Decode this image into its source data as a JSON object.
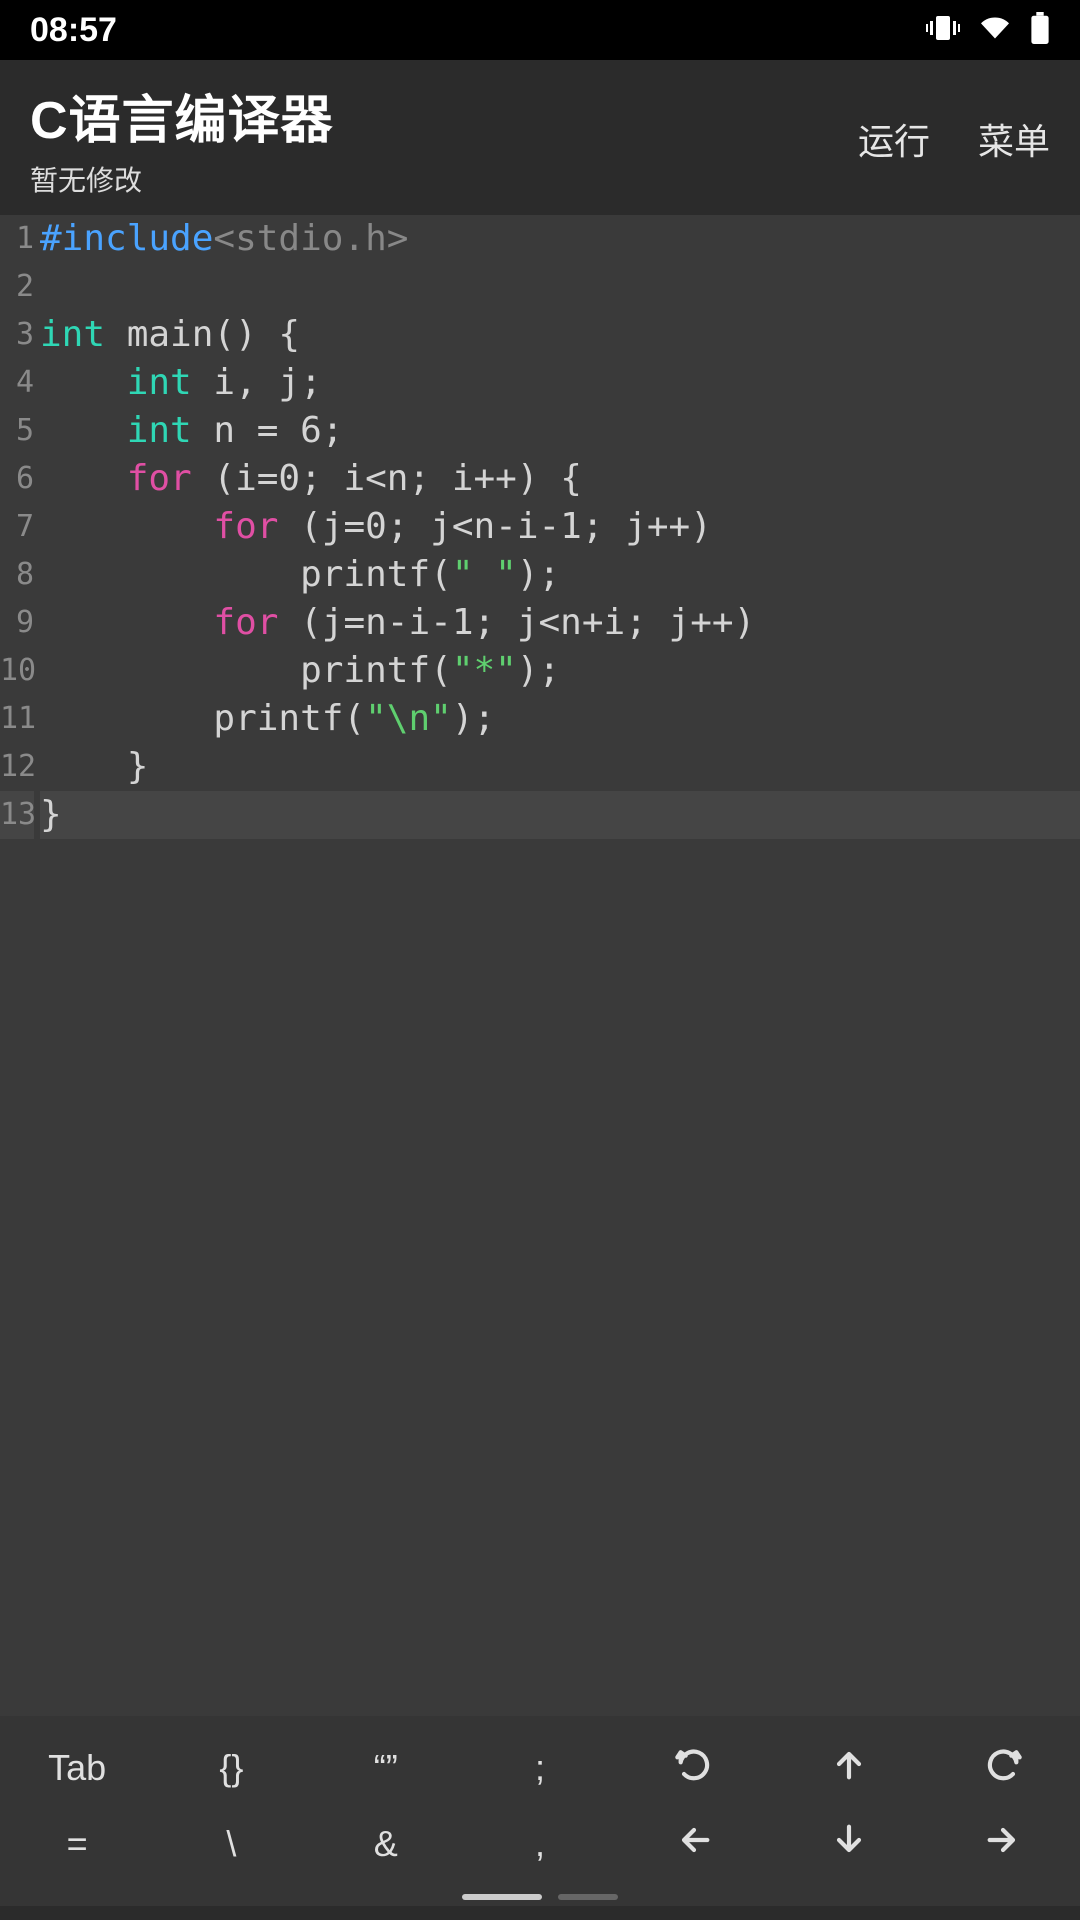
{
  "status": {
    "time": "08:57"
  },
  "header": {
    "title": "C语言编译器",
    "subtitle": "暂无修改",
    "run_label": "运行",
    "menu_label": "菜单"
  },
  "code": {
    "lines": [
      {
        "no": "1",
        "tokens": [
          {
            "t": "#include",
            "c": "tok-kw-blue"
          },
          {
            "t": "<stdio.h>",
            "c": "tok-ghost"
          }
        ]
      },
      {
        "no": "2",
        "tokens": [
          {
            "t": "",
            "c": ""
          }
        ]
      },
      {
        "no": "3",
        "tokens": [
          {
            "t": "int",
            "c": "tok-type"
          },
          {
            "t": " main() {",
            "c": ""
          }
        ]
      },
      {
        "no": "4",
        "tokens": [
          {
            "t": "    ",
            "c": ""
          },
          {
            "t": "int",
            "c": "tok-type"
          },
          {
            "t": " i, j;",
            "c": ""
          }
        ]
      },
      {
        "no": "5",
        "tokens": [
          {
            "t": "    ",
            "c": ""
          },
          {
            "t": "int",
            "c": "tok-type"
          },
          {
            "t": " n = 6;",
            "c": ""
          }
        ]
      },
      {
        "no": "6",
        "tokens": [
          {
            "t": "    ",
            "c": ""
          },
          {
            "t": "for",
            "c": "tok-kw-mag"
          },
          {
            "t": " (i=0; i<n; i++) {",
            "c": ""
          }
        ]
      },
      {
        "no": "7",
        "tokens": [
          {
            "t": "        ",
            "c": ""
          },
          {
            "t": "for",
            "c": "tok-kw-mag"
          },
          {
            "t": " (j=0; j<n-i-1; j++)",
            "c": ""
          }
        ]
      },
      {
        "no": "8",
        "tokens": [
          {
            "t": "            printf(",
            "c": ""
          },
          {
            "t": "\" \"",
            "c": "tok-str"
          },
          {
            "t": ");",
            "c": ""
          }
        ]
      },
      {
        "no": "9",
        "tokens": [
          {
            "t": "        ",
            "c": ""
          },
          {
            "t": "for",
            "c": "tok-kw-mag"
          },
          {
            "t": " (j=n-i-1; j<n+i; j++)",
            "c": ""
          }
        ]
      },
      {
        "no": "10",
        "tokens": [
          {
            "t": "            printf(",
            "c": ""
          },
          {
            "t": "\"*\"",
            "c": "tok-str"
          },
          {
            "t": ");",
            "c": ""
          }
        ]
      },
      {
        "no": "11",
        "tokens": [
          {
            "t": "        printf(",
            "c": ""
          },
          {
            "t": "\"\\n\"",
            "c": "tok-str"
          },
          {
            "t": ");",
            "c": ""
          }
        ]
      },
      {
        "no": "12",
        "tokens": [
          {
            "t": "    }",
            "c": ""
          }
        ]
      },
      {
        "no": "13",
        "tokens": [
          {
            "t": "}",
            "c": ""
          }
        ],
        "active": true
      }
    ]
  },
  "keybar": {
    "row1": [
      "Tab",
      "{}",
      "“”",
      ";",
      "undo-icon",
      "arrow-up-icon",
      "redo-icon"
    ],
    "row2": [
      "=",
      "\\",
      "&",
      ",",
      "arrow-left-icon",
      "arrow-down-icon",
      "arrow-right-icon"
    ]
  }
}
